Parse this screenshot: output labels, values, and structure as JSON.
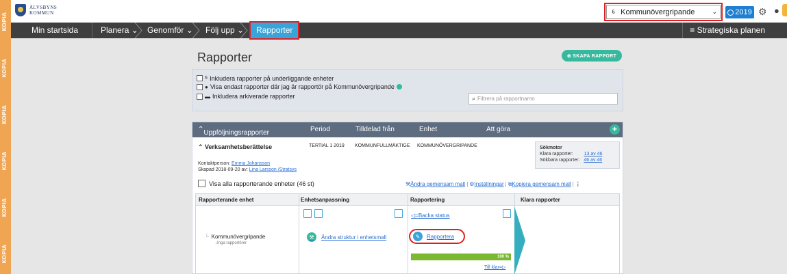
{
  "watermark": "KOPIA",
  "logo": {
    "line1": "ÄLVSBYNS",
    "line2": "KOMMUN"
  },
  "header": {
    "unit_select": "Kommunövergripande",
    "year": "2019"
  },
  "nav": {
    "items": [
      "Min startsida",
      "Planera ⌄",
      "Genomför ⌄",
      "Följ upp ⌄",
      "Rapporter"
    ],
    "right": "≡ Strategiska planen"
  },
  "page": {
    "title": "Rapporter",
    "create_button": "⊕ SKAPA RAPPORT"
  },
  "filters": {
    "include_sub": "Inkludera rapporter på underliggande enheter",
    "only_mine": "Visa endast rapporter där jag är rapportör på Kommunövergripande",
    "include_archived": "Inkludera arkiverade rapporter",
    "search_placeholder": "Filtrera på rapportnamn"
  },
  "panel": {
    "header": {
      "title": "Uppföljningsrapporter",
      "period": "Period",
      "assigned_from": "Tilldelad från",
      "unit": "Enhet",
      "todo": "Att göra"
    },
    "report": {
      "name": "Verksamhetsberättelse",
      "period": "TERTIAL 1 2019",
      "assigned_from": "KOMMUNFULLMÄKTIGE",
      "unit": "KOMMUNÖVERGRIPANDE",
      "contact_label": "Kontaktperson:",
      "contact_name": "Emma Johansson",
      "created_label": "Skapad 2018-09-20 av:",
      "created_by": "Lina Larsson /Stratsys"
    },
    "sokmotor": {
      "title": "Sökmotor",
      "ready_label": "Klara rapporter:",
      "ready_value": "13 av 46",
      "searchable_label": "Sökbara rapporter:",
      "searchable_value": "46 av 46"
    },
    "show_all": "Visa alla rapporterande enheter (46 st)",
    "actions": {
      "change_template": "Ändra gemensam mall",
      "settings": "Inställningar",
      "copy_template": "Kopiera gemensam mall"
    },
    "columns": [
      "Rapporterande enhet",
      "Enhetsanpassning",
      "Rapportering",
      "Klara rapporter"
    ],
    "row": {
      "unit": "Kommunövergripande",
      "reporters": "Inga rapportörer",
      "change_structure": "Ändra struktur i enhetsmall",
      "back_status": "Backa status",
      "report_action": "Rapportera",
      "progress_label": "100 %",
      "progress_fraction": 1.0,
      "to_ready": "Till klar"
    }
  },
  "colors": {
    "accent_blue": "#3aa3d8",
    "green": "#37b99e",
    "highlight_red": "#e02020",
    "watermark_orange": "#f0a553"
  }
}
